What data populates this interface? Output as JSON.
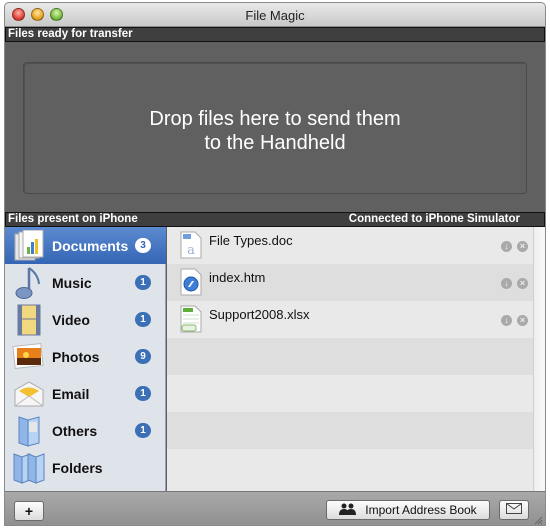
{
  "window": {
    "title": "File Magic"
  },
  "transfer": {
    "header": "Files ready for transfer",
    "drop_text": "Drop files here to send them\nto the Handheld"
  },
  "device": {
    "header": "Files present on iPhone",
    "status": "Connected to iPhone Simulator"
  },
  "sidebar": {
    "items": [
      {
        "label": "Documents",
        "count": "3",
        "icon": "documents-icon",
        "selected": true
      },
      {
        "label": "Music",
        "count": "1",
        "icon": "music-note-icon",
        "selected": false
      },
      {
        "label": "Video",
        "count": "1",
        "icon": "film-strip-icon",
        "selected": false
      },
      {
        "label": "Photos",
        "count": "9",
        "icon": "photo-icon",
        "selected": false
      },
      {
        "label": "Email",
        "count": "1",
        "icon": "envelope-icon",
        "selected": false
      },
      {
        "label": "Others",
        "count": "1",
        "icon": "folder-icon",
        "selected": false
      },
      {
        "label": "Folders",
        "count": null,
        "icon": "folders-icon",
        "selected": false
      }
    ]
  },
  "files": [
    {
      "name": "File Types.doc",
      "icon": "doc-file-icon"
    },
    {
      "name": "index.htm",
      "icon": "html-file-icon"
    },
    {
      "name": "Support2008.xlsx",
      "icon": "xlsx-file-icon"
    }
  ],
  "row_actions": {
    "download": "download-icon",
    "remove": "remove-icon"
  },
  "bottom": {
    "add_label": "+",
    "import_label": "Import Address Book"
  },
  "colors": {
    "selection": "#3466b5",
    "badge": "#3b6fb6"
  }
}
